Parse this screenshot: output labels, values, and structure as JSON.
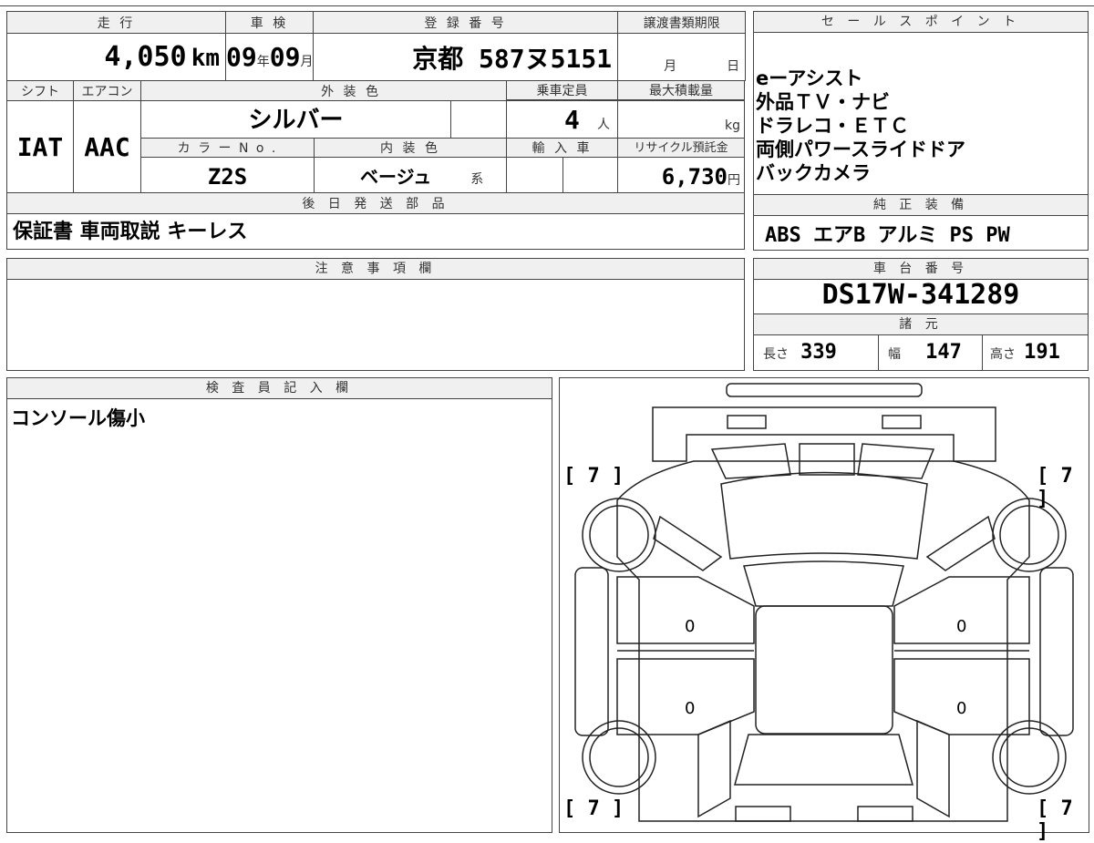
{
  "top": {
    "mileage_label": "走 行",
    "mileage_value": "4,050",
    "mileage_unit": "km",
    "inspection_label": "車 検",
    "inspection_year": "09",
    "year_unit": "年",
    "inspection_month": "09",
    "month_unit": "月",
    "registration_label": "登 録 番 号",
    "registration_value": "京都 587ヌ5151",
    "transfer_docs_label": "譲渡書類期限",
    "transfer_docs_month": "月",
    "transfer_docs_day": "日",
    "shift_label": "シフト",
    "shift_value": "IAT",
    "ac_label": "エアコン",
    "ac_value": "AAC",
    "exterior_color_label": "外 装 色",
    "exterior_color_value": "シルバー",
    "capacity_label": "乗車定員",
    "capacity_value": "4",
    "capacity_unit": "人",
    "max_load_label": "最大積載量",
    "max_load_unit": "kg",
    "color_no_label": "カ ラ ー N o .",
    "color_no_value": "Z2S",
    "interior_color_label": "内 装 色",
    "interior_color_value": "ベージュ",
    "interior_color_suffix": "系",
    "import_label": "輸 入 車",
    "recycle_label": "リサイクル預託金",
    "recycle_value": "6,730",
    "recycle_unit": "円",
    "later_parts_label": "後 日 発 送 部 品",
    "later_parts_value": "保証書 車両取説 キーレス"
  },
  "sales_points": {
    "label": "セ ー ル ス ポ イ ン ト",
    "lines": [
      "eーアシスト",
      "外品ＴＶ・ナビ",
      "ドラレコ・ＥＴＣ",
      "両側パワースライドドア",
      "バックカメラ"
    ]
  },
  "genuine_equipment": {
    "label": "純 正 装 備",
    "value": "ABS エアB アルミ PS PW"
  },
  "notes": {
    "label": "注 意 事 項 欄",
    "value": ""
  },
  "chassis": {
    "label": "車 台 番 号",
    "value": "DS17W-341289"
  },
  "specs": {
    "label": "諸 元",
    "length_label": "長さ",
    "length_value": "339",
    "width_label": "幅",
    "width_value": "147",
    "height_label": "高さ",
    "height_value": "191"
  },
  "inspector": {
    "label": "検 査 員 記 入 欄",
    "value": "コンソール傷小"
  },
  "diagram": {
    "tire_depth_top_left": "[ 7 ]",
    "tire_depth_top_right": "[ 7 ]",
    "tire_depth_bottom_left": "[ 7 ]",
    "tire_depth_bottom_right": "[ 7 ]",
    "panel_mark_front_left": "0",
    "panel_mark_rear_left": "0",
    "panel_mark_front_right": "0",
    "panel_mark_rear_right": "0"
  }
}
